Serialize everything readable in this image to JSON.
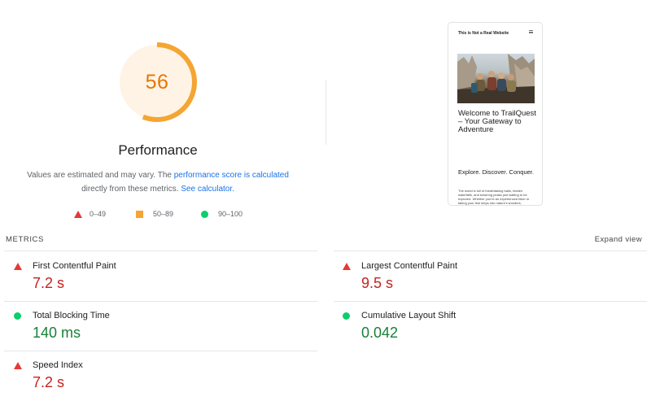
{
  "gauge": {
    "score": "56",
    "score_value": 56,
    "title": "Performance",
    "color": "#f4a532",
    "fill_color": "#fff3e6"
  },
  "note": {
    "prefix": "Values are estimated and may vary. The ",
    "link1": "performance score is calculated",
    "middle": "directly from these metrics. ",
    "link2": "See calculator."
  },
  "legend": [
    {
      "range": "0–49",
      "icon": "red-triangle-icon",
      "color": "#e53935"
    },
    {
      "range": "50–89",
      "icon": "orange-square-icon",
      "color": "#f4a532"
    },
    {
      "range": "90–100",
      "icon": "green-circle-icon",
      "color": "#0cce6b"
    }
  ],
  "preview": {
    "site_name": "This is Not a Real Website",
    "headline": "Welcome to TrailQuest – Your Gateway to Adventure",
    "tagline": "Explore. Discover. Conquer.",
    "body": "The world is full of breathtaking trails, hidden waterfalls, and towering peaks just waiting to be explored. Whether you're an experienced hiker or taking your first steps into nature's wonders, TrailQuest is your ultimate guide to finding, preparing for, and conquering the best trails around"
  },
  "metrics": {
    "label": "METRICS",
    "expand": "Expand view",
    "items": [
      {
        "name": "First Contentful Paint",
        "value": "7.2 s",
        "status": "poor"
      },
      {
        "name": "Largest Contentful Paint",
        "value": "9.5 s",
        "status": "poor"
      },
      {
        "name": "Total Blocking Time",
        "value": "140 ms",
        "status": "good"
      },
      {
        "name": "Cumulative Layout Shift",
        "value": "0.042",
        "status": "good"
      },
      {
        "name": "Speed Index",
        "value": "7.2 s",
        "status": "poor"
      }
    ]
  },
  "colors": {
    "poor": "#c5221f",
    "good": "#188038",
    "link": "#1a73e8"
  }
}
